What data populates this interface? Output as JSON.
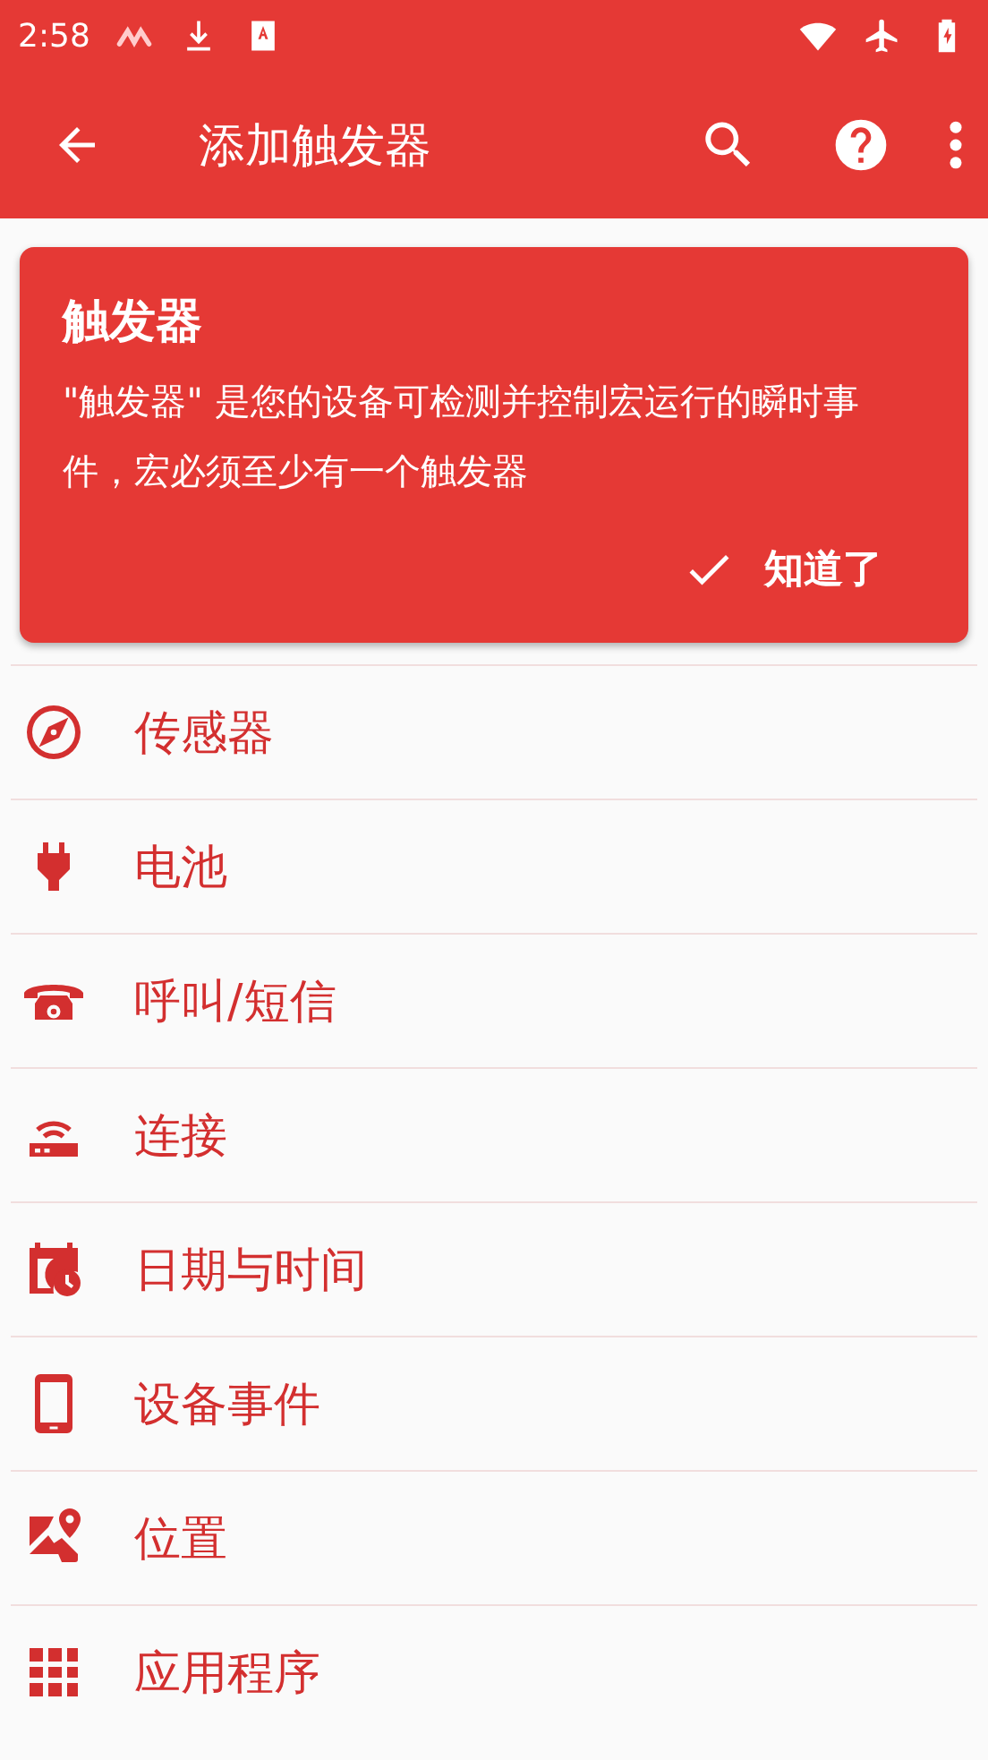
{
  "status_bar": {
    "time": "2:58"
  },
  "toolbar": {
    "title": "添加触发器"
  },
  "info_card": {
    "title": "触发器",
    "body": "\"触发器\" 是您的设备可检测并控制宏运行的瞬时事件，宏必须至少有一个触发器",
    "action": "知道了"
  },
  "categories": [
    {
      "label": "传感器"
    },
    {
      "label": "电池"
    },
    {
      "label": "呼叫/短信"
    },
    {
      "label": "连接"
    },
    {
      "label": "日期与时间"
    },
    {
      "label": "设备事件"
    },
    {
      "label": "位置"
    },
    {
      "label": "应用程序"
    }
  ]
}
